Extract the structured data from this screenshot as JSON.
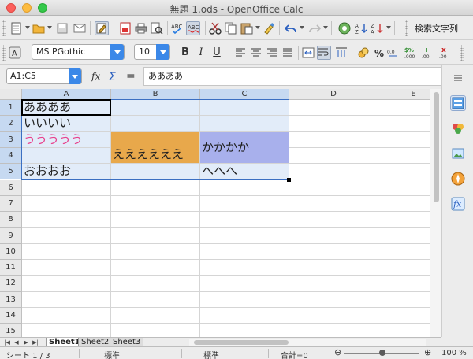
{
  "window": {
    "title": "無題 1.ods - OpenOffice Calc"
  },
  "toolbar": {
    "search_label": "検索文字列",
    "font_name": "MS PGothic",
    "font_size": "10",
    "bold": "B",
    "italic": "I",
    "underline": "U"
  },
  "formula": {
    "name_box": "A1:C5",
    "content": "ああああ"
  },
  "columns": [
    "A",
    "B",
    "C",
    "D",
    "E"
  ],
  "rows": [
    "1",
    "2",
    "3",
    "4",
    "5",
    "6",
    "7",
    "8",
    "9",
    "10",
    "11",
    "12",
    "13",
    "14",
    "15"
  ],
  "cells": {
    "A1": "ああああ",
    "A2": "いいいい",
    "A3": "ううううう",
    "B4": "ええええええ",
    "C3": "かかかか",
    "A5": "おおおお",
    "C5": "へへへ"
  },
  "colors": {
    "a3_text": "#e8418c",
    "b_orange": "#e8a84b",
    "c_purple": "#a8b0ec"
  },
  "sheets": [
    "Sheet1",
    "Sheet2",
    "Sheet3"
  ],
  "status": {
    "sheet": "シート 1 / 3",
    "style": "標準",
    "mode": "標準",
    "sum": "合計=0",
    "zoom": "100 %"
  }
}
